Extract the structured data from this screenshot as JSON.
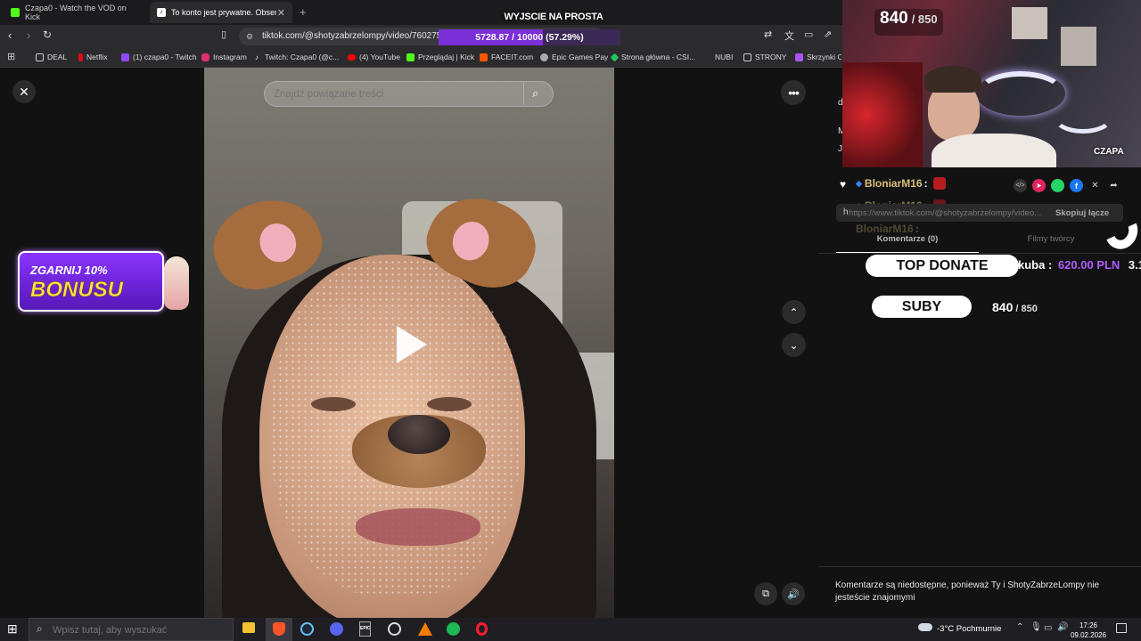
{
  "browser": {
    "tabs": [
      {
        "title": "Czapa0 - Watch the VOD on Kick",
        "favicon_color": "#53fc18"
      },
      {
        "title": "To konto jest prywatne. Obserwu",
        "favicon_color": "#ffffff"
      }
    ],
    "url": "tiktok.com/@shotyzabrzelompy/video/7602759",
    "bookmarks": [
      {
        "label": "DEAL",
        "icon": "folder-icon"
      },
      {
        "label": "Netflix",
        "icon": "netflix-icon",
        "color": "#e50914"
      },
      {
        "label": "(1) czapa0 - Twitch",
        "icon": "twitch-icon",
        "color": "#9146ff"
      },
      {
        "label": "Instagram",
        "icon": "instagram-icon",
        "color": "#e1306c"
      },
      {
        "label": "Twitch: Czapa0 (@c...",
        "icon": "tiktok-icon",
        "color": "#ffffff"
      },
      {
        "label": "(4) YouTube",
        "icon": "youtube-icon",
        "color": "#ff0000"
      },
      {
        "label": "Przeglądaj | Kick",
        "icon": "kick-icon",
        "color": "#53fc18"
      },
      {
        "label": "FACEIT.com",
        "icon": "faceit-icon",
        "color": "#ff5500"
      },
      {
        "label": "Epic Games Pay",
        "icon": "globe-icon",
        "color": "#aaaaaa"
      },
      {
        "label": "Strona główna - CSI...",
        "icon": "csi-icon",
        "color": "#22c55e"
      },
      {
        "label": "NUBI",
        "icon": "none"
      },
      {
        "label": "STRONY",
        "icon": "folder-icon"
      },
      {
        "label": "Skrzynki CS",
        "icon": "crate-icon",
        "color": "#a855f7"
      }
    ]
  },
  "overlay": {
    "goal_title": "WYJSCIE NA PROSTA",
    "goal_progress_text": "5728.87 / 10000 (57.29%)",
    "goal_progress_fraction": 0.5729,
    "sub_count": "840",
    "sub_goal": "/ 850",
    "cam_label": "CZAPA",
    "promo_line1": "ZGARNIJ 10%",
    "promo_line2": "BONUSU",
    "top_donate_label": "TOP DONATE",
    "top_donate_name": "kuba :",
    "top_donate_amount": "620.00 PLN",
    "top_donate_extra": "3.1",
    "suby_label": "SUBY",
    "suby_count": "840",
    "suby_goal": "/ 850",
    "chat_user": "BloniarM16",
    "chat_user_colon": ":"
  },
  "tiktok": {
    "search_placeholder": "Znajdź powiązane treści",
    "share_link": "https://www.tiktok.com/@shotyzabrzelompy/video...",
    "copy_link_label": "Skopiuj łącze",
    "tab_comments": "Komentarze (0)",
    "tab_creator_videos": "Filmy twórcy",
    "comments_disabled_msg": "Komentarze są niedostępne, ponieważ Ty i ShotyZabrzeLompy nie jesteście znajomymi",
    "side_letters": [
      "d",
      "M",
      "J"
    ],
    "link_prefix": "h"
  },
  "taskbar": {
    "search_placeholder": "Wpisz tutaj, aby wyszukać",
    "weather": "-3°C  Pochmurnie",
    "time": "17:26",
    "date": "09.02.2026",
    "epic_label": "EPIC"
  },
  "colors": {
    "progress_purple": "#7b2fd6",
    "donate_amount": "#b25cff",
    "chat_name": "#d6c07a",
    "promo_bg": "#6a1fc9",
    "promo_text": "#ffe14a"
  }
}
